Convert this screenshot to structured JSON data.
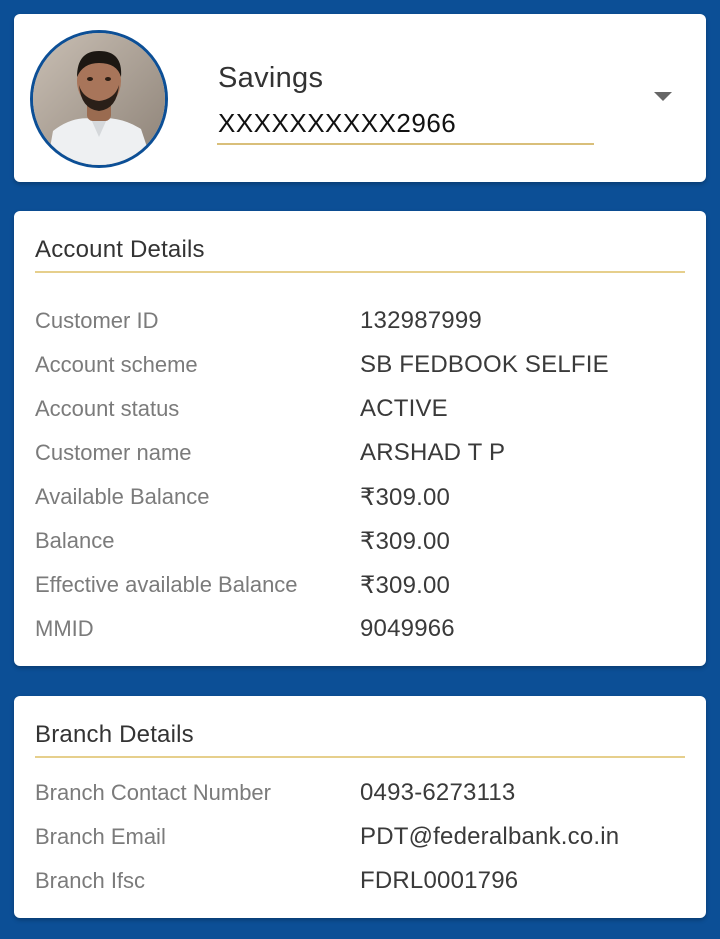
{
  "account_selector": {
    "type": "Savings",
    "number": "XXXXXXXXXX2966"
  },
  "account_details": {
    "title": "Account Details",
    "rows": [
      {
        "label": "Customer ID",
        "value": "132987999"
      },
      {
        "label": "Account scheme",
        "value": "SB FEDBOOK SELFIE"
      },
      {
        "label": "Account status",
        "value": "ACTIVE"
      },
      {
        "label": "Customer name",
        "value": "ARSHAD T P"
      },
      {
        "label": "Available Balance",
        "value": "₹309.00"
      },
      {
        "label": "Balance",
        "value": "₹309.00"
      },
      {
        "label": "Effective available Balance",
        "value": "₹309.00"
      },
      {
        "label": "MMID",
        "value": "9049966"
      }
    ]
  },
  "branch_details": {
    "title": "Branch Details",
    "rows": [
      {
        "label": "Branch Contact Number",
        "value": "0493-6273113"
      },
      {
        "label": "Branch Email",
        "value": "PDT@federalbank.co.in"
      },
      {
        "label": "Branch Ifsc",
        "value": "FDRL0001796"
      }
    ]
  },
  "colors": {
    "background": "#0c4f96",
    "card": "#ffffff",
    "accent_rule": "#e6cf8c",
    "label": "#7b7b7b",
    "value": "#3a3a3a"
  },
  "icons": {
    "dropdown": "caret-down-icon"
  }
}
